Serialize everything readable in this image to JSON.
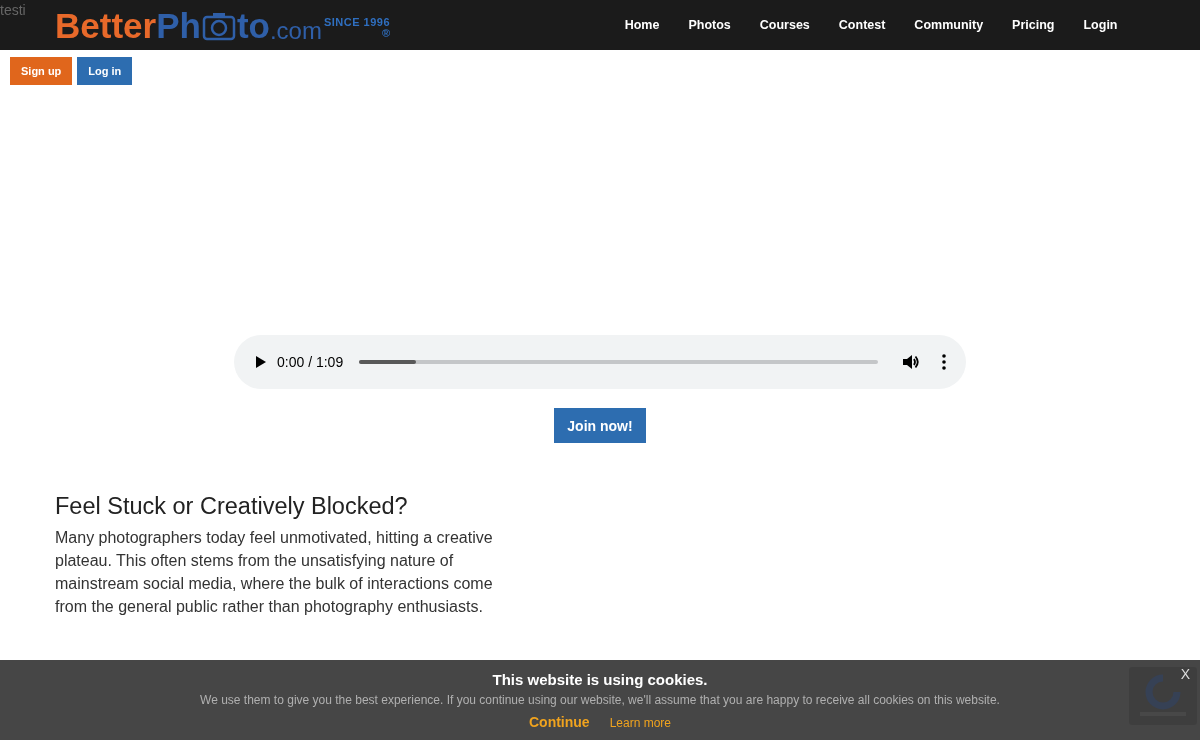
{
  "corner_text": "testi",
  "logo": {
    "part_1": "Better",
    "part_2": "Ph",
    "part_3": "to",
    "domain": ".com",
    "tagline": "SINCE 1996",
    "mark": "®"
  },
  "nav": [
    "Home",
    "Photos",
    "Courses",
    "Contest",
    "Community",
    "Pricing",
    "Login"
  ],
  "auth_buttons": [
    {
      "label": "Sign up",
      "kind": "signup"
    },
    {
      "label": "Log in",
      "kind": "login"
    }
  ],
  "audio_player": {
    "time": "0:00 / 1:09",
    "level": 0.11
  },
  "join_button": "Join now!",
  "section": {
    "heading": "Feel Stuck or Creatively Blocked?",
    "paragraph": "Many photographers today feel unmotivated, hitting a creative plateau. This often stems from the unsatisfying nature of mainstream social media, where the bulk of interactions come from the general public rather than photography enthusiasts."
  },
  "cookie_banner": {
    "title": "This website is using cookies.",
    "message": "We use them to give you the best experience. If you continue using our website, we'll assume that you are happy to receive all cookies on this website.",
    "continue": "Continue",
    "learn_more": "Learn more",
    "close": "X"
  }
}
